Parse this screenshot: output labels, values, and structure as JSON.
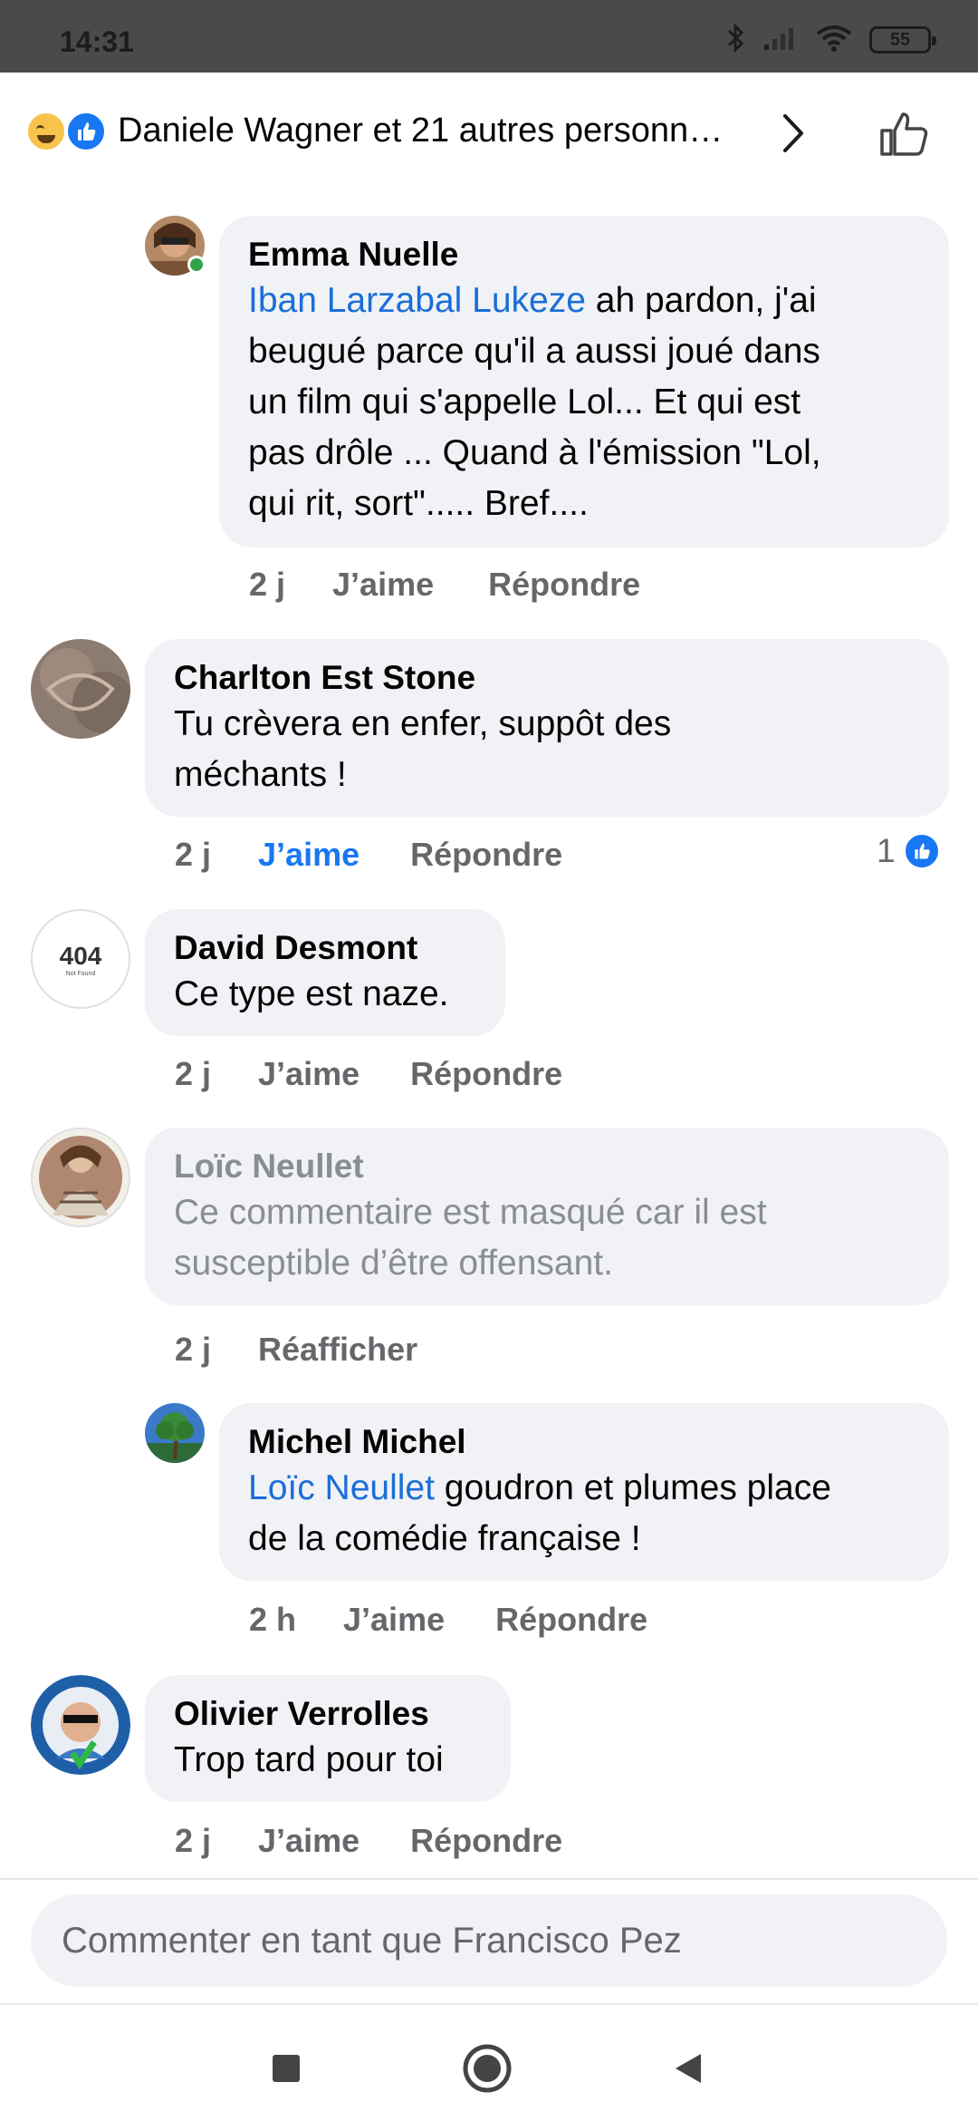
{
  "status_bar": {
    "time": "14:31",
    "battery": "55",
    "icons": [
      "bluetooth-icon",
      "signal-icon",
      "wifi-icon",
      "battery-icon"
    ]
  },
  "reactions_header": {
    "reactors_text": "Daniele Wagner et 21 autres personn…",
    "reaction_icons": [
      "haha-reaction-icon",
      "like-reaction-icon"
    ]
  },
  "comments": [
    {
      "author": "Emma Nuelle",
      "mention": "Iban Larzabal Lukeze",
      "lines": [
        " ah pardon, j'ai",
        "beugué parce qu'il a aussi joué dans",
        "un film qui s'appelle Lol... Et qui est",
        "pas drôle ... Quand à l'émission \"Lol,",
        "qui rit, sort\"..... Bref...."
      ],
      "time": "2 j",
      "like_label": "J’aime",
      "reply_label": "Répondre"
    },
    {
      "author": "Charlton Est Stone",
      "lines": [
        "Tu crèvera en enfer, suppôt des",
        "méchants !"
      ],
      "time": "2 j",
      "like_label": "J’aime",
      "reply_label": "Répondre",
      "like_count": "1"
    },
    {
      "author": "David Desmont",
      "avatar_text": "404",
      "avatar_subtext": "Not Found",
      "lines": [
        "Ce type est naze."
      ],
      "time": "2 j",
      "like_label": "J’aime",
      "reply_label": "Répondre"
    },
    {
      "author": "Loïc Neullet",
      "lines": [
        "Ce commentaire est masqué car il est",
        "susceptible d’être offensant."
      ],
      "time": "2 j",
      "unhide_label": "Réafficher"
    },
    {
      "author": "Michel Michel",
      "mention": "Loïc Neullet",
      "lines": [
        " goudron et plumes place",
        "de la comédie française !"
      ],
      "time": "2 h",
      "like_label": "J’aime",
      "reply_label": "Répondre"
    },
    {
      "author": "Olivier Verrolles",
      "lines": [
        "Trop tard pour toi"
      ],
      "time": "2 j",
      "like_label": "J’aime",
      "reply_label": "Répondre"
    }
  ],
  "composer": {
    "placeholder": "Commenter en tant que Francisco Pez"
  },
  "nav_bar": {
    "buttons": [
      "recents-square-icon",
      "home-circle-icon",
      "back-triangle-icon"
    ]
  },
  "colors": {
    "accent": "#1877f2",
    "mention": "#1a6ed8",
    "bubble": "#f0f2f5",
    "secondary_text": "#65676b",
    "statusbar": "#4a4a4a"
  }
}
